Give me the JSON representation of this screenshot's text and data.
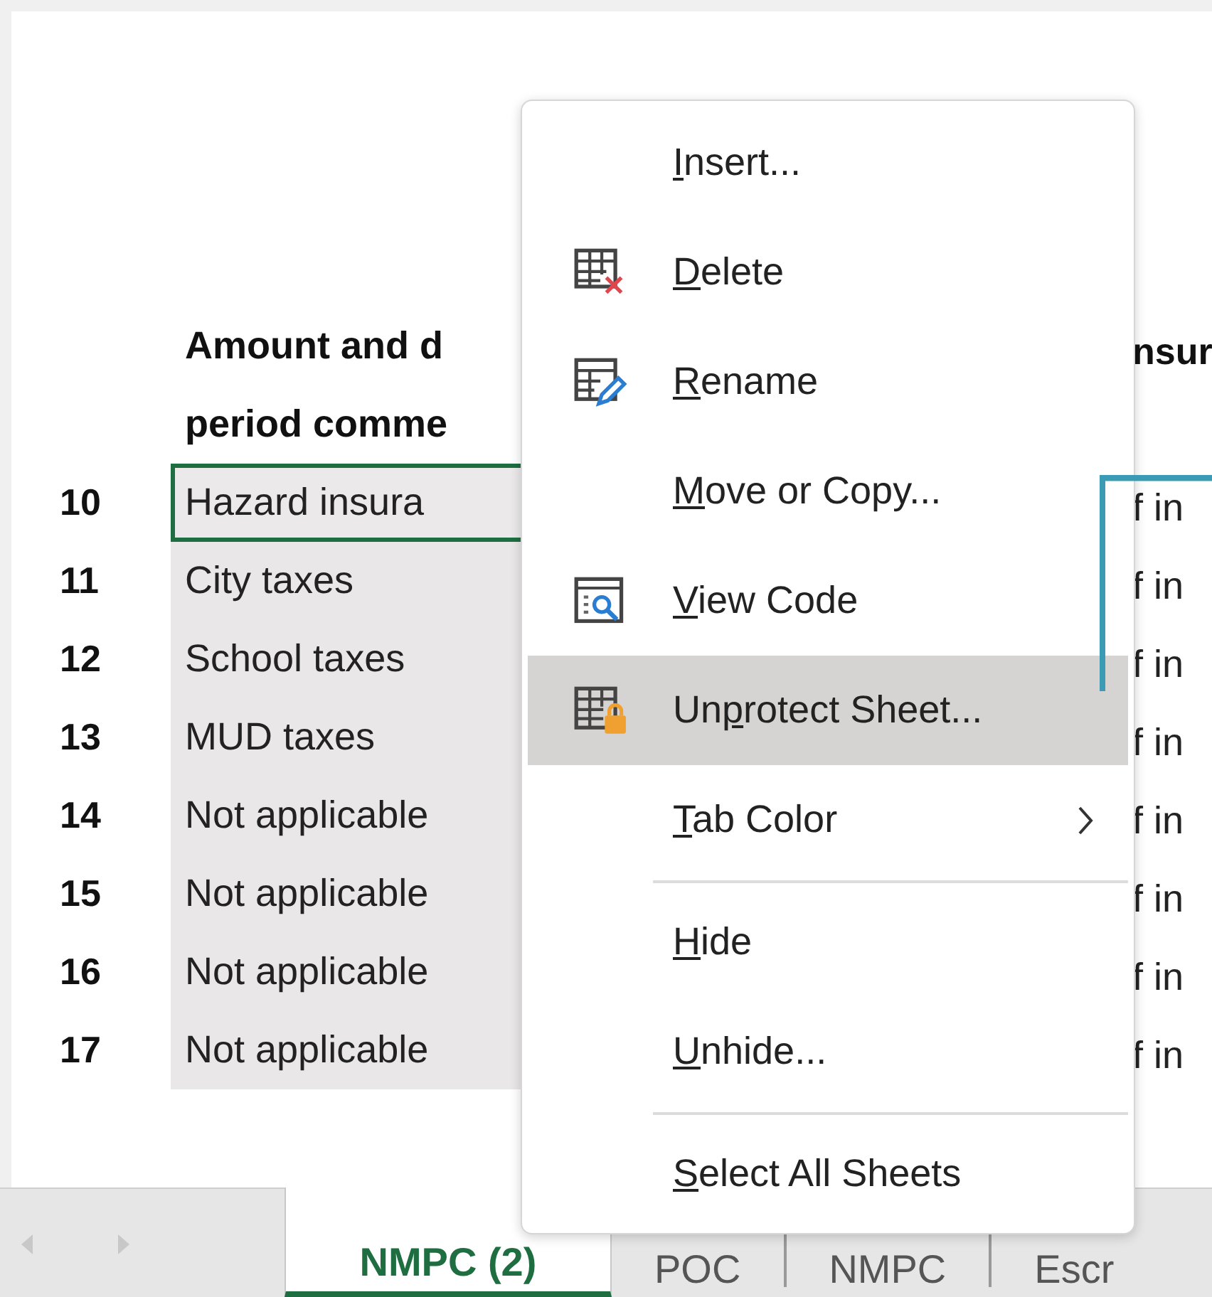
{
  "sheet": {
    "header_lines": [
      {
        "column_1": "Amount and d",
        "column_2": "nsur"
      },
      {
        "column_1": "period comme"
      }
    ],
    "rows": [
      {
        "number": "10",
        "column_1": "Hazard insura",
        "column_2": "f in",
        "selected": true
      },
      {
        "number": "11",
        "column_1": "City taxes",
        "column_2": "f in",
        "selected": false
      },
      {
        "number": "12",
        "column_1": "School taxes",
        "column_2": "f in",
        "selected": false
      },
      {
        "number": "13",
        "column_1": "MUD taxes",
        "column_2": "f in",
        "selected": false
      },
      {
        "number": "14",
        "column_1": "Not applicable",
        "column_2": "f in",
        "selected": false
      },
      {
        "number": "15",
        "column_1": "Not applicable",
        "column_2": "f in",
        "selected": false
      },
      {
        "number": "16",
        "column_1": "Not applicable",
        "column_2": "f in",
        "selected": false
      },
      {
        "number": "17",
        "column_1": "Not applicable",
        "column_2": "f in",
        "selected": false
      }
    ]
  },
  "context_menu": {
    "items": [
      {
        "kind": "item",
        "key": "I",
        "after": "nsert...",
        "highlighted": false,
        "submenu": false
      },
      {
        "kind": "item",
        "key": "D",
        "after": "elete",
        "highlighted": false,
        "submenu": false
      },
      {
        "kind": "item",
        "key": "R",
        "after": "ename",
        "highlighted": false,
        "submenu": false
      },
      {
        "kind": "item",
        "key": "M",
        "after": "ove or Copy...",
        "highlighted": false,
        "submenu": false
      },
      {
        "kind": "item",
        "key": "V",
        "after": "iew Code",
        "highlighted": false,
        "submenu": false
      },
      {
        "kind": "item",
        "before": "Un",
        "key": "p",
        "after": "rotect Sheet...",
        "highlighted": true,
        "submenu": false
      },
      {
        "kind": "item",
        "key": "T",
        "after": "ab Color",
        "highlighted": false,
        "submenu": true
      },
      {
        "kind": "separator"
      },
      {
        "kind": "item",
        "key": "H",
        "after": "ide",
        "highlighted": false,
        "submenu": false
      },
      {
        "kind": "item",
        "key": "U",
        "after": "nhide...",
        "highlighted": false,
        "submenu": false
      },
      {
        "kind": "separator"
      },
      {
        "kind": "item",
        "key": "S",
        "after": "elect All Sheets",
        "highlighted": false,
        "submenu": false
      }
    ]
  },
  "sheet_tabs": [
    {
      "label": "NMPC (2)",
      "selected": true
    },
    {
      "label": "POC",
      "selected": false
    },
    {
      "label": "NMPC",
      "selected": false
    },
    {
      "label": "Escr",
      "selected": false
    }
  ]
}
